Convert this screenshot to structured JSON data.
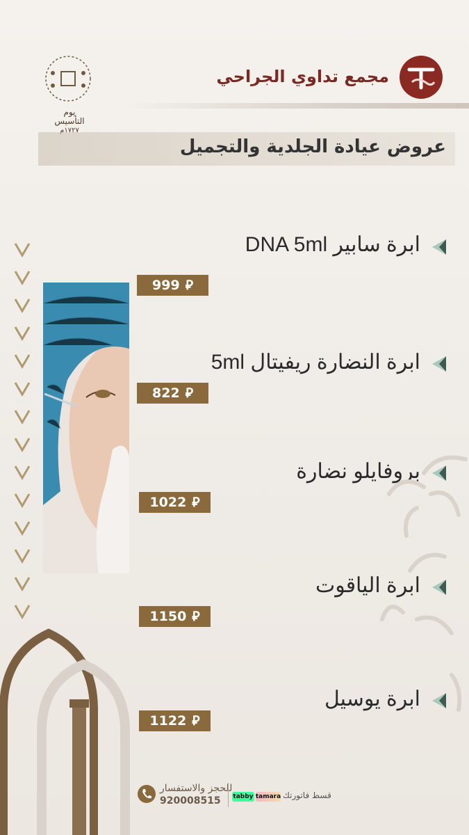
{
  "header": {
    "clinic_name": "مجمع تداوي الجراحي",
    "founding_day_line1": "يوم",
    "founding_day_line2": "التأسيس",
    "founding_year": "١٧٢٧م"
  },
  "section": {
    "title": "عروض عيادة الجلدية والتجميل"
  },
  "currency_symbol": "⃁",
  "offers": [
    {
      "name": "ابرة سابير DNA 5ml",
      "price": "999"
    },
    {
      "name": "ابرة النضارة ريفيتال 5ml",
      "price": "822"
    },
    {
      "name": "بروفايلو نضارة",
      "price": "1022"
    },
    {
      "name": "ابرة الياقوت",
      "price": "1150"
    },
    {
      "name": "ابرة يوسيل",
      "price": "1122"
    }
  ],
  "footer": {
    "booking_label": "للحجز والاستفسار",
    "phone": "920008515",
    "tabby": "tabby",
    "tamara": "tamara",
    "installment_label": "قسط فاتورتك"
  },
  "colors": {
    "brand_red": "#8b2a22",
    "gold": "#8a6a3c",
    "bullet_teal": "#a9c8bd"
  }
}
